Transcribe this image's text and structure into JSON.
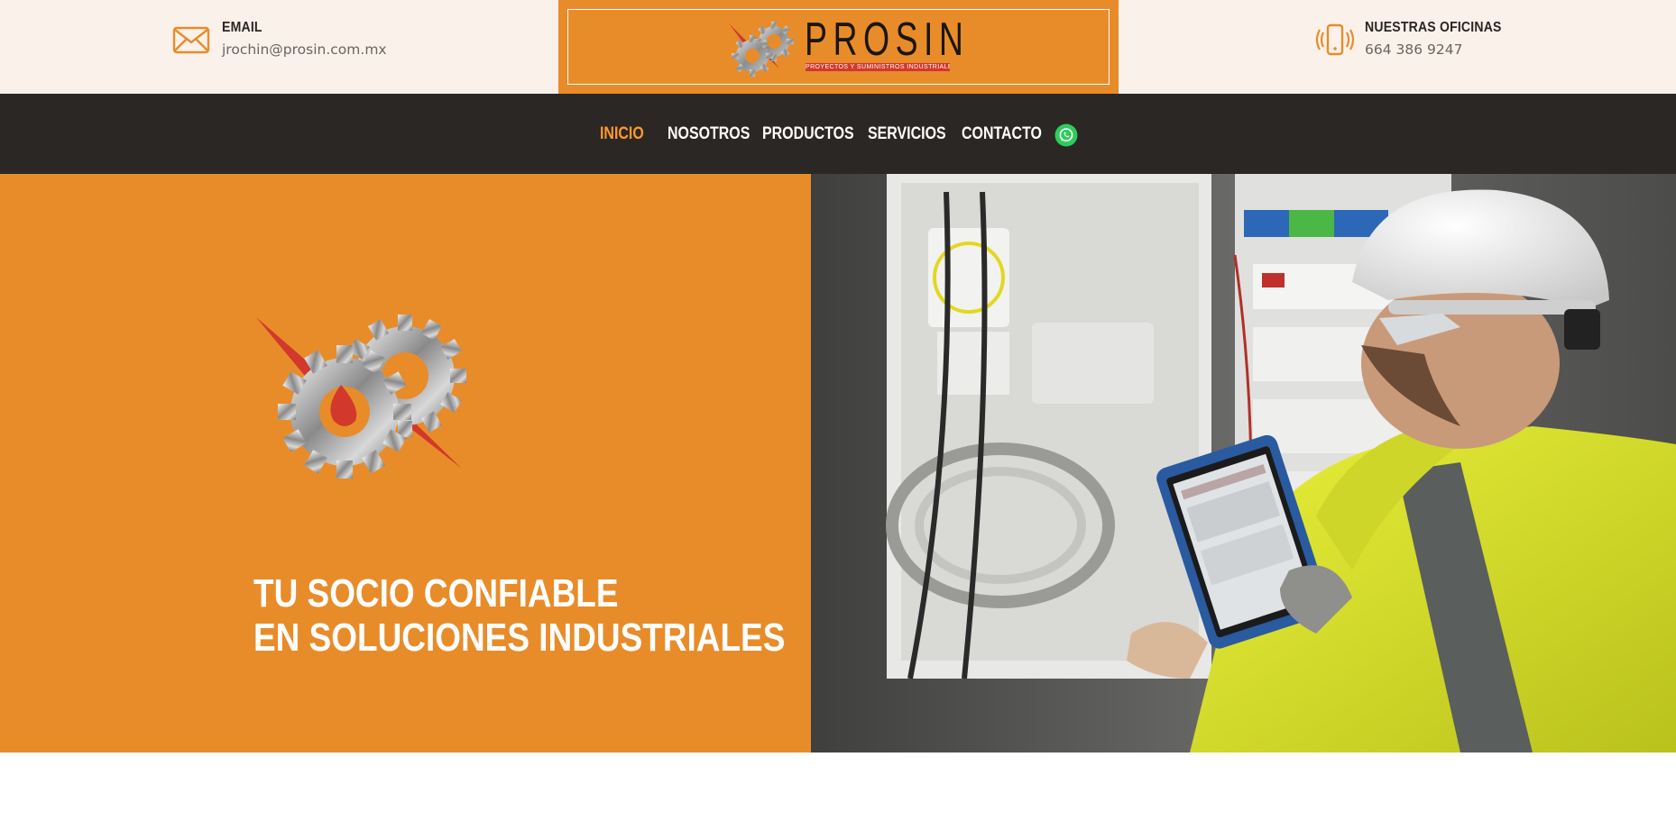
{
  "header": {
    "email": {
      "label": "EMAIL",
      "value": "jrochin@prosin.com.mx",
      "icon": "envelope-icon"
    },
    "office": {
      "label": "NUESTRAS OFICINAS",
      "value": "664 386 9247",
      "icon": "phone-vibrate-icon"
    },
    "logo": {
      "wordmark": "PROSIN",
      "tagline": "PROYECTOS Y SUMINISTROS INDUSTRIALES"
    }
  },
  "nav": {
    "items": [
      {
        "label": "INICIO",
        "active": true
      },
      {
        "label": "NOSOTROS",
        "active": false
      },
      {
        "label": "PRODUCTOS",
        "active": false
      },
      {
        "label": "SERVICIOS",
        "active": false
      },
      {
        "label": "CONTACTO",
        "active": false
      }
    ],
    "whatsapp_icon": "whatsapp-icon"
  },
  "hero": {
    "title_line1": "TU SOCIO CONFIABLE",
    "title_line2": "EN SOLUCIONES INDUSTRIALES",
    "photo": "electrician-with-tablet-photo"
  },
  "colors": {
    "accent": "#e88c2a",
    "nav_bg": "#2b2724",
    "topbar_bg": "#f9f1ea",
    "active_nav": "#ff9a2e",
    "logo_red": "#d2382b"
  }
}
